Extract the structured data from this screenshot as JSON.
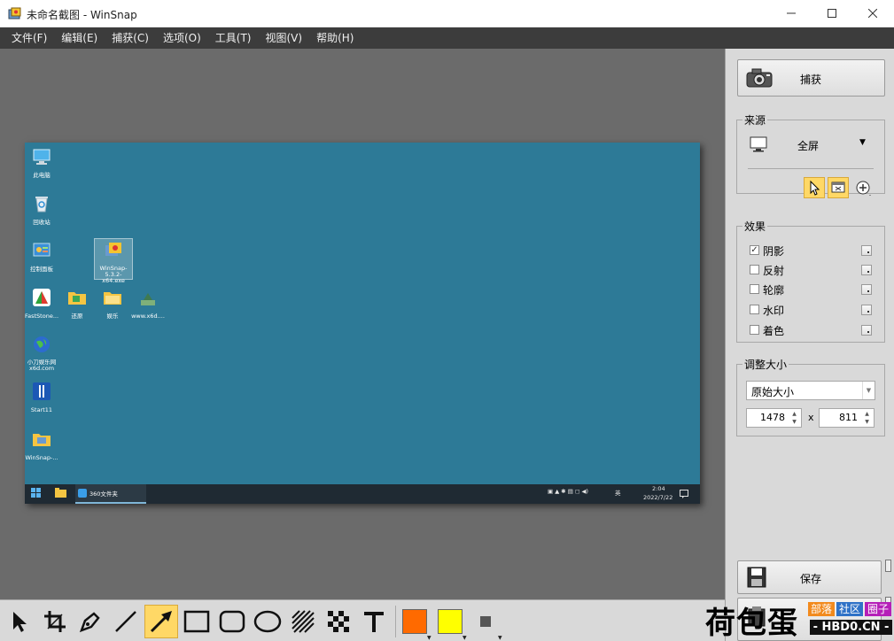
{
  "window": {
    "title": "未命名截图 - WinSnap",
    "icon": "winsnap-app-icon",
    "controls": [
      "minimize-icon",
      "maximize-icon",
      "close-icon"
    ]
  },
  "menu": [
    {
      "label": "文件(F)"
    },
    {
      "label": "编辑(E)"
    },
    {
      "label": "捕获(C)"
    },
    {
      "label": "选项(O)"
    },
    {
      "label": "工具(T)"
    },
    {
      "label": "视图(V)"
    },
    {
      "label": "帮助(H)"
    }
  ],
  "screenshot": {
    "desktop_background": "#2d7a97",
    "icons": [
      {
        "label": "此电脑",
        "icon": "computer-icon"
      },
      {
        "label": "回收站",
        "icon": "recycle-bin-icon"
      },
      {
        "label": "控制面板",
        "icon": "control-panel-icon"
      },
      {
        "label": "WinSnap-5.3.2-x64.exe",
        "icon": "winsnap-installer-icon"
      },
      {
        "label": "FastStone...",
        "icon": "faststone-icon"
      },
      {
        "label": "还原",
        "icon": "folder-icon"
      },
      {
        "label": "娱乐",
        "icon": "folder-icon"
      },
      {
        "label": "www.x6d....",
        "icon": "shortcut-icon"
      },
      {
        "label": "小刀娱乐网 x6d.com",
        "icon": "globe-icon"
      },
      {
        "label": "Start11",
        "icon": "start11-icon"
      },
      {
        "label": "WinSnap-...",
        "icon": "folder-icon"
      }
    ],
    "taskbar": {
      "active_window": "360文件夹",
      "tray_lang": "英",
      "time": "2:04",
      "date": "2022/7/22"
    }
  },
  "panel": {
    "capture_label": "捕获",
    "source": {
      "title": "来源",
      "mode": "全屏"
    },
    "effects": {
      "title": "效果",
      "items": [
        {
          "label": "阴影",
          "checked": true
        },
        {
          "label": "反射",
          "checked": false
        },
        {
          "label": "轮廓",
          "checked": false
        },
        {
          "label": "水印",
          "checked": false
        },
        {
          "label": "着色",
          "checked": false
        }
      ],
      "check_mark": "✓"
    },
    "resize": {
      "title": "调整大小",
      "mode": "原始大小",
      "width": "1478",
      "separator": "x",
      "height": "811"
    },
    "save_label": "保存"
  },
  "toolbar": {
    "tools": [
      "pointer-tool-icon",
      "crop-tool-icon",
      "pen-tool-icon",
      "line-tool-icon",
      "arrow-tool-icon",
      "rectangle-tool-icon",
      "rounded-rectangle-tool-icon",
      "ellipse-tool-icon",
      "hatch-tool-icon",
      "pixelate-tool-icon",
      "text-tool-icon"
    ],
    "active_tool": "arrow-tool-icon",
    "colors": {
      "primary": "#ff6a00",
      "secondary": "#ffff00",
      "line": "#555555"
    }
  },
  "watermark": {
    "text": "荷包蛋",
    "tags": [
      "部落",
      "社区",
      "圈子"
    ],
    "site": "- HBD0.CN -"
  }
}
